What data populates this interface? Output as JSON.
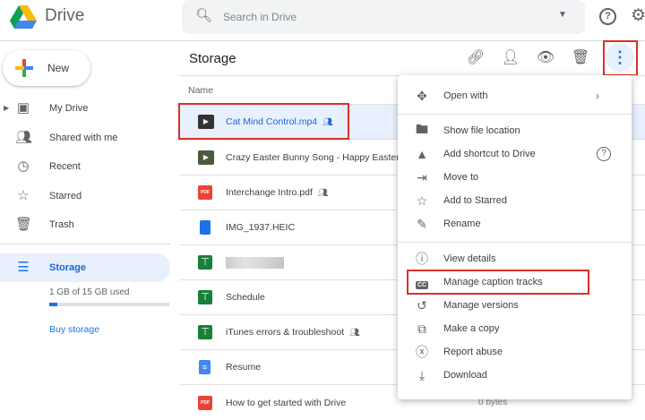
{
  "app": {
    "title": "Drive"
  },
  "search": {
    "placeholder": "Search in Drive"
  },
  "sidebar": {
    "new_label": "New",
    "items": [
      {
        "label": "My Drive",
        "icon": "my-drive-icon"
      },
      {
        "label": "Shared with me",
        "icon": "people-icon"
      },
      {
        "label": "Recent",
        "icon": "clock-icon"
      },
      {
        "label": "Starred",
        "icon": "star-icon"
      },
      {
        "label": "Trash",
        "icon": "trash-icon"
      }
    ],
    "storage_label": "Storage",
    "usage": "1 GB of 15 GB used",
    "usage_fraction": 0.07,
    "buy_storage": "Buy storage"
  },
  "main": {
    "title": "Storage",
    "name_header": "Name",
    "files": [
      {
        "name": "Cat Mind Control.mp4",
        "type": "video",
        "shared": true,
        "selected": true
      },
      {
        "name": "Crazy Easter Bunny Song - Happy Easter",
        "type": "video",
        "shared": false
      },
      {
        "name": "Interchange Intro.pdf",
        "type": "pdf",
        "shared": true
      },
      {
        "name": "IMG_1937.HEIC",
        "type": "file",
        "shared": false
      },
      {
        "name": "",
        "type": "sheet",
        "shared": false,
        "blurred": true
      },
      {
        "name": "Schedule",
        "type": "sheet",
        "shared": false
      },
      {
        "name": "iTunes errors & troubleshoot",
        "type": "sheet",
        "shared": true
      },
      {
        "name": "Resume",
        "type": "doc",
        "shared": false
      },
      {
        "name": "How to get started with Drive",
        "type": "pdf",
        "shared": false,
        "size": "0 bytes"
      }
    ]
  },
  "context_menu": {
    "items": [
      {
        "label": "Open with",
        "icon": "open-with-icon"
      },
      {
        "label": "Show file location",
        "icon": "folder-icon"
      },
      {
        "label": "Add shortcut to Drive",
        "icon": "add-shortcut-icon"
      },
      {
        "label": "Move to",
        "icon": "move-to-icon"
      },
      {
        "label": "Add to Starred",
        "icon": "star-icon"
      },
      {
        "label": "Rename",
        "icon": "pencil-icon"
      },
      {
        "label": "View details",
        "icon": "info-icon"
      },
      {
        "label": "Manage caption tracks",
        "icon": "cc-icon"
      },
      {
        "label": "Manage versions",
        "icon": "history-icon"
      },
      {
        "label": "Make a copy",
        "icon": "copy-icon"
      },
      {
        "label": "Report abuse",
        "icon": "report-icon"
      },
      {
        "label": "Download",
        "icon": "download-icon"
      }
    ]
  },
  "colors": {
    "accent": "#1a73e8",
    "highlight": "#d93025",
    "selected_bg": "#e8f0fe"
  }
}
